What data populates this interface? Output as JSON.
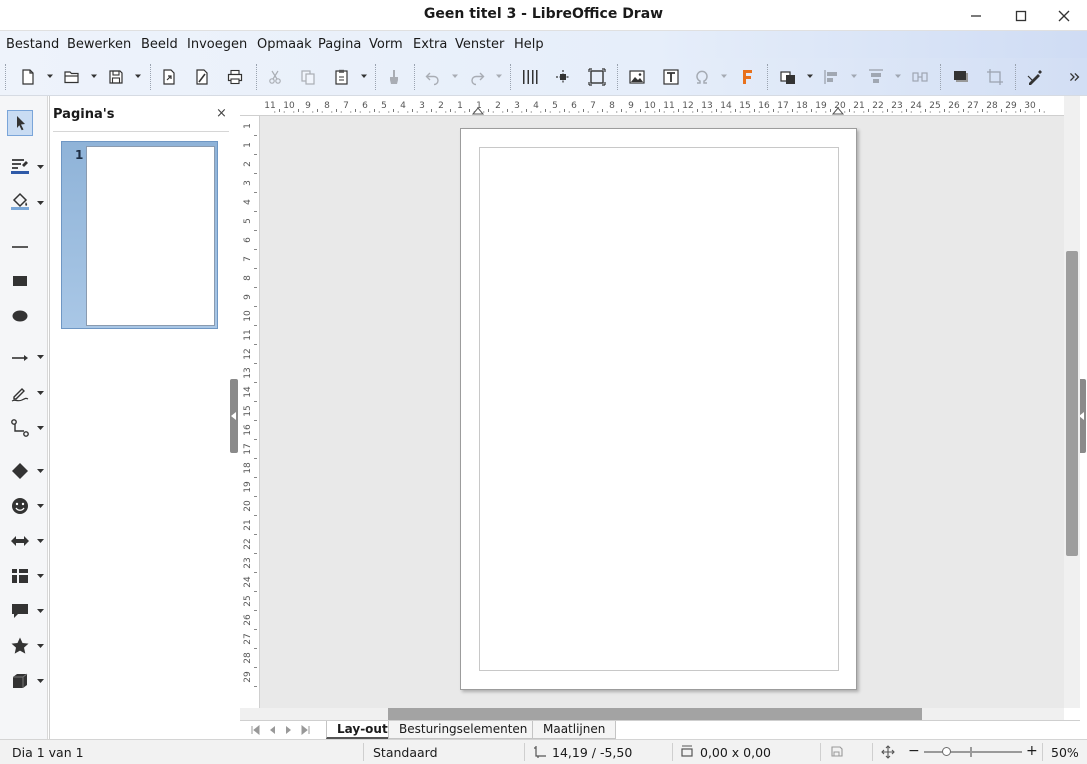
{
  "window": {
    "title": "Geen titel 3 - LibreOffice Draw"
  },
  "menu": [
    "Bestand",
    "Bewerken",
    "Beeld",
    "Invoegen",
    "Opmaak",
    "Pagina",
    "Vorm",
    "Extra",
    "Venster",
    "Help"
  ],
  "pages_panel": {
    "title": "Pagina's",
    "close": "×",
    "page_number": "1"
  },
  "ruler": {
    "horizontal": [
      "11",
      "10",
      "9",
      "8",
      "7",
      "6",
      "5",
      "4",
      "3",
      "2",
      "1",
      "1",
      "2",
      "3",
      "4",
      "5",
      "6",
      "7",
      "8",
      "9",
      "10",
      "11",
      "12",
      "13",
      "14",
      "15",
      "16",
      "17",
      "18",
      "19",
      "20",
      "21",
      "22",
      "23",
      "24",
      "25",
      "26",
      "27",
      "28",
      "29",
      "30"
    ],
    "vertical": [
      "1",
      "1",
      "2",
      "3",
      "4",
      "5",
      "6",
      "7",
      "8",
      "9",
      "10",
      "11",
      "12",
      "13",
      "14",
      "15",
      "16",
      "17",
      "18",
      "19",
      "20",
      "21",
      "22",
      "23",
      "24",
      "25",
      "26",
      "27",
      "28",
      "29"
    ]
  },
  "tabs": [
    "Lay-out",
    "Besturingselementen",
    "Maatlijnen"
  ],
  "status": {
    "slide": "Dia 1 van 1",
    "style": "Standaard",
    "position": "14,19 / -5,50",
    "size": "0,00 x 0,00",
    "zoom_minus": "−",
    "zoom_plus": "+",
    "zoom": "50%"
  },
  "colors": {
    "accent": "#3c78c2",
    "selection": "#a9c7e6"
  }
}
